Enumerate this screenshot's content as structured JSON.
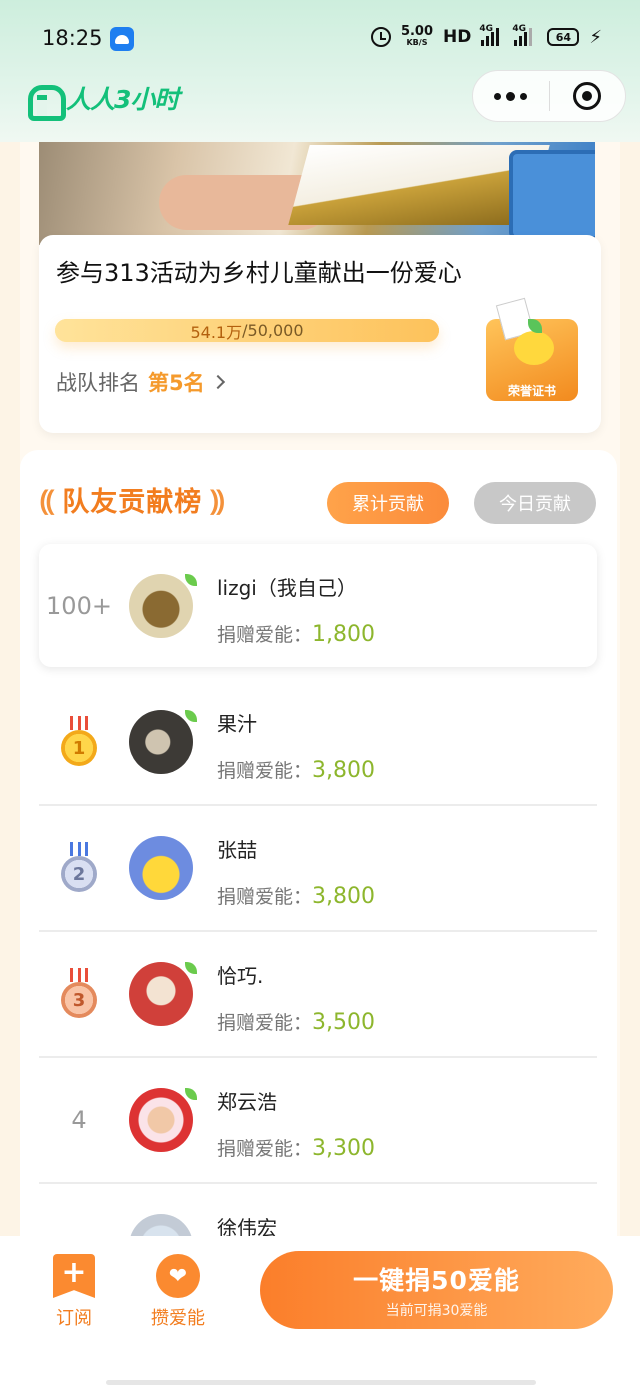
{
  "status_bar": {
    "time": "18:25",
    "net_speed_value": "5.00",
    "net_speed_unit": "KB/S",
    "hd_label": "HD",
    "signal1_label": "4G",
    "signal2_label": "4G",
    "battery": "64"
  },
  "header": {
    "brand_name": "人人3小时"
  },
  "activity": {
    "title": "参与313活动为乡村儿童献出一份爱心",
    "progress_current": "54.1万",
    "progress_target": "/50,000",
    "progress_percent": 100,
    "team_rank_label": "战队排名",
    "team_rank_value": "第5名",
    "certificate_label": "荣誉证书"
  },
  "leaderboard": {
    "title": "队友贡献榜",
    "tabs": [
      {
        "label": "累计贡献",
        "active": true
      },
      {
        "label": "今日贡献",
        "active": false
      }
    ],
    "donation_label": "捐赠爱能：",
    "me": {
      "rank": "100+",
      "name": "lizgi（我自己）",
      "amount": "1,800"
    },
    "rows": [
      {
        "rank": "1",
        "medal": "gold",
        "name": "果汁",
        "amount": "3,800"
      },
      {
        "rank": "2",
        "medal": "silver",
        "name": "张喆",
        "amount": "3,800"
      },
      {
        "rank": "3",
        "medal": "bronze",
        "name": "恰巧.",
        "amount": "3,500"
      },
      {
        "rank": "4",
        "medal": "",
        "name": "郑云浩",
        "amount": "3,300"
      },
      {
        "rank": "",
        "medal": "",
        "name": "徐伟宏",
        "amount": ""
      }
    ]
  },
  "bottom_bar": {
    "subscribe_label": "订阅",
    "collect_label": "攒爱能",
    "donate_main": "一键捐50爱能",
    "donate_sub": "当前可捐30爱能"
  },
  "colors": {
    "brand_green": "#13c07a",
    "accent_orange": "#fb8a30",
    "amount_green": "#8db62d",
    "rank_orange": "#f59a2c"
  }
}
